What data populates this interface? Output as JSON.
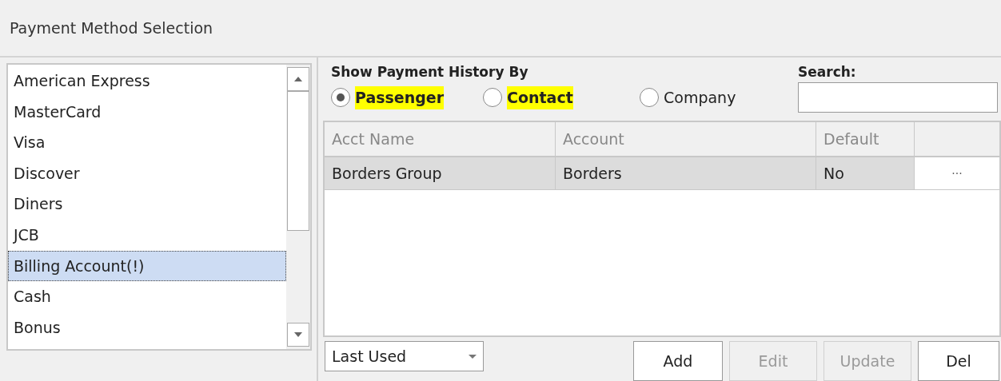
{
  "window": {
    "title": "Payment Method Selection"
  },
  "payment_methods": [
    {
      "label": "American Express",
      "selected": false
    },
    {
      "label": "MasterCard",
      "selected": false
    },
    {
      "label": "Visa",
      "selected": false
    },
    {
      "label": "Discover",
      "selected": false
    },
    {
      "label": "Diners",
      "selected": false
    },
    {
      "label": "JCB",
      "selected": false
    },
    {
      "label": "Billing Account(!)",
      "selected": true
    },
    {
      "label": "Cash",
      "selected": false
    },
    {
      "label": "Bonus",
      "selected": false
    }
  ],
  "history": {
    "heading": "Show Payment History By",
    "options": [
      {
        "label": "Passenger",
        "selected": true,
        "highlighted": true
      },
      {
        "label": "Contact",
        "selected": false,
        "highlighted": true
      },
      {
        "label": "Company",
        "selected": false,
        "highlighted": false
      }
    ]
  },
  "search": {
    "label": "Search:"
  },
  "table": {
    "columns": [
      "Acct Name",
      "Account",
      "Default"
    ],
    "rows": [
      {
        "cells": [
          "Borders Group",
          "Borders",
          "No"
        ],
        "action": "···"
      }
    ]
  },
  "sort": {
    "value": "Last Used"
  },
  "buttons": [
    {
      "label": "Add",
      "disabled": false
    },
    {
      "label": "Edit",
      "disabled": true
    },
    {
      "label": "Update",
      "disabled": true
    },
    {
      "label": "Del",
      "disabled": false
    }
  ]
}
